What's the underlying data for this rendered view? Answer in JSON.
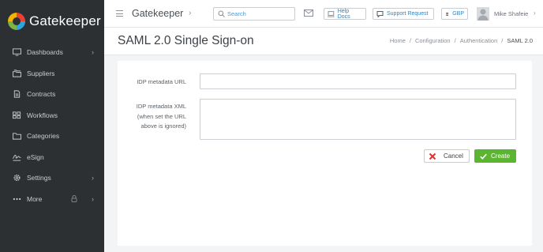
{
  "brand": {
    "name": "Gatekeeper"
  },
  "sidebar": {
    "items": [
      {
        "label": "Dashboards",
        "icon": "monitor-icon",
        "chevron": true
      },
      {
        "label": "Suppliers",
        "icon": "folders-icon",
        "chevron": false
      },
      {
        "label": "Contracts",
        "icon": "document-icon",
        "chevron": false
      },
      {
        "label": "Workflows",
        "icon": "grid-icon",
        "chevron": false
      },
      {
        "label": "Categories",
        "icon": "category-folder-icon",
        "chevron": false
      },
      {
        "label": "eSign",
        "icon": "signature-icon",
        "chevron": false
      },
      {
        "label": "Settings",
        "icon": "gear-icon",
        "chevron": true
      },
      {
        "label": "More",
        "icon": "dots-icon",
        "chevron": true
      }
    ],
    "chevron_glyph": "›"
  },
  "topbar": {
    "app_title": "Gatekeeper",
    "app_title_chevron": "›",
    "search_placeholder": "Search",
    "help_docs": "Help Docs",
    "support_request": "Support Request",
    "currency": "GBP",
    "user_name": "Mike Shafeie",
    "user_chevron": "›"
  },
  "page": {
    "title": "SAML 2.0 Single Sign-on",
    "breadcrumb": [
      "Home",
      "Configuration",
      "Authentication",
      "SAML 2.0"
    ],
    "breadcrumb_sep": "/"
  },
  "form": {
    "idp_url_label": "IDP metadata URL",
    "idp_url_value": "",
    "idp_xml_label_lines": [
      "IDP metadata XML",
      "(when set the URL",
      "above is ignored)"
    ],
    "idp_xml_value": "",
    "cancel_label": "Cancel",
    "create_label": "Create"
  },
  "colors": {
    "sidebar_bg": "#2d3033",
    "accent_green": "#5cb531",
    "link_blue": "#2f86c4",
    "cancel_red": "#e3302f"
  }
}
